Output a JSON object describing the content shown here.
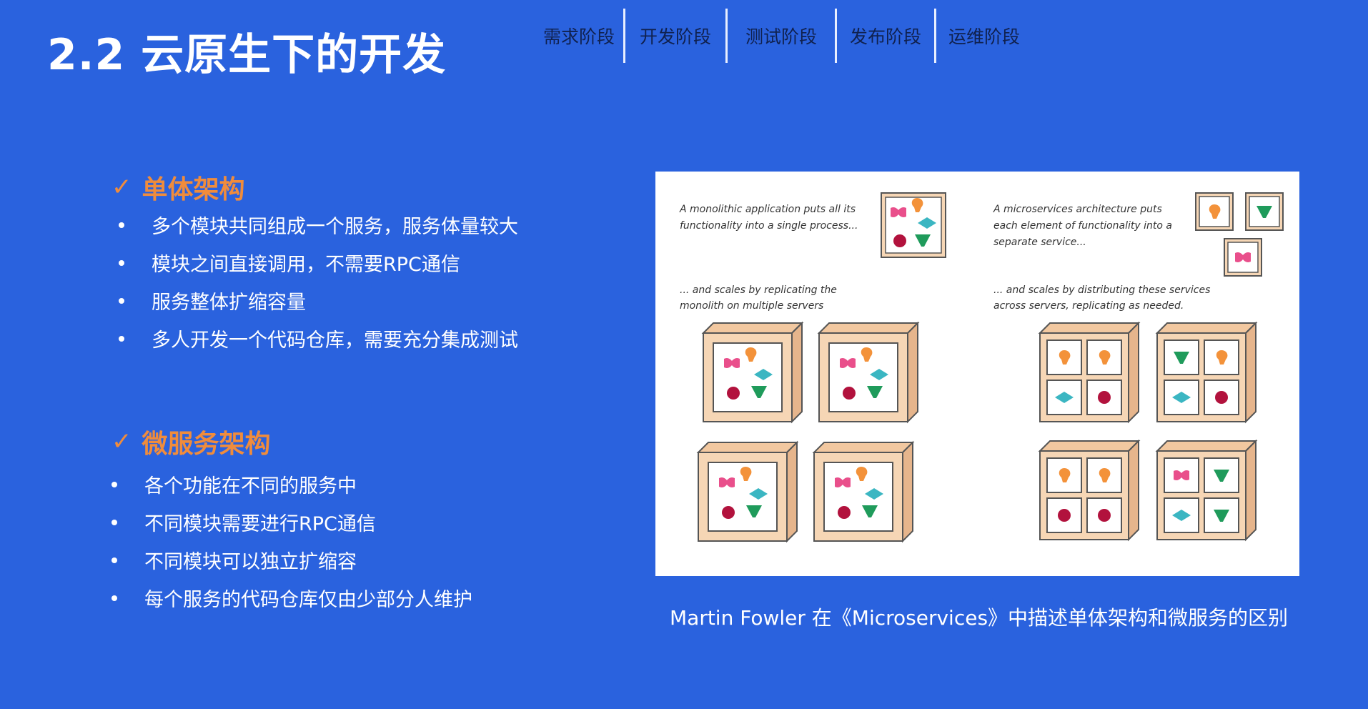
{
  "title": "2.2 云原生下的开发",
  "stages": [
    "需求阶段",
    "开发阶段",
    "测试阶段",
    "发布阶段",
    "运维阶段"
  ],
  "sections": [
    {
      "heading": "单体架构",
      "bullets": [
        "多个模块共同组成一个服务，服务体量较大",
        "模块之间直接调用，不需要RPC通信",
        "服务整体扩缩容量",
        "多人开发一个代码仓库，需要充分集成测试"
      ]
    },
    {
      "heading": "微服务架构",
      "bullets": [
        "各个功能在不同的服务中",
        "不同模块需要进行RPC通信",
        "不同模块可以独立扩缩容",
        "每个服务的代码仓库仅由少部分人维护"
      ]
    }
  ],
  "figure": {
    "mono_desc": [
      "A monolithic application puts all its",
      "functionality into a single process..."
    ],
    "mono_scale": [
      "... and scales by replicating the",
      "monolith on multiple servers"
    ],
    "micro_desc": [
      "A microservices architecture puts",
      "each element of functionality into a",
      "separate service..."
    ],
    "micro_scale": [
      "... and scales by distributing these services",
      "across servers, replicating as needed."
    ]
  },
  "caption": "Martin Fowler 在《Microservices》中描述单体架构和微服务的区别",
  "colors": {
    "background": "#2a62de",
    "heading_accent": "#f08c3c",
    "stage_text": "#10214f",
    "server_box": "#f6d6b5",
    "shape_pink": "#e94f8b",
    "shape_orange": "#f3923a",
    "shape_teal": "#3bb6c2",
    "shape_crimson": "#b2123d",
    "shape_green": "#1f9b5b"
  }
}
